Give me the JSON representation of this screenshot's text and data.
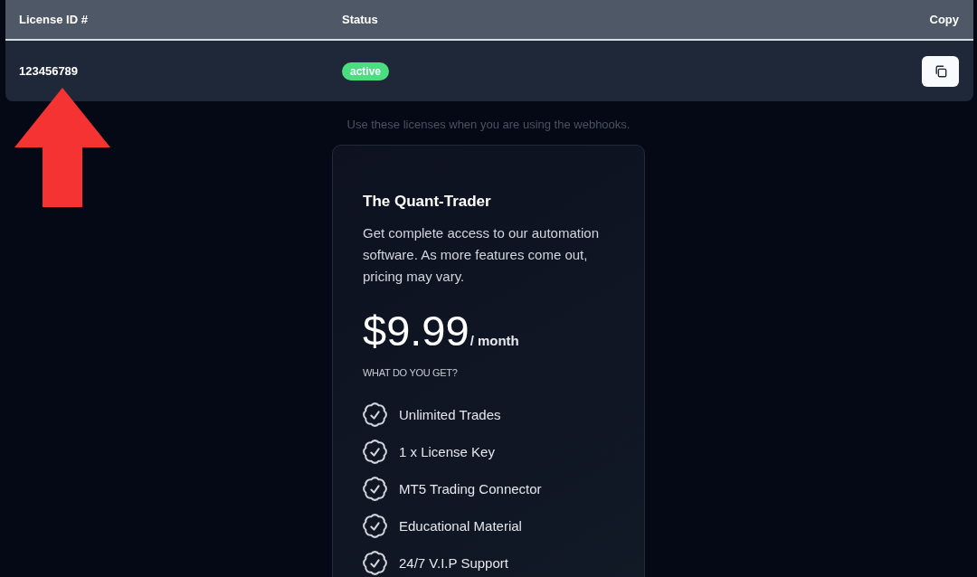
{
  "table": {
    "columns": [
      "License ID #",
      "Status",
      "Copy"
    ],
    "rows": [
      {
        "license_id": "123456789",
        "status": "active"
      }
    ]
  },
  "note": "Use these licenses when you are using the webhooks.",
  "plan": {
    "title": "The Quant-Trader",
    "description": "Get complete access to our automation software. As more features come out, pricing may vary.",
    "price": "$9.99",
    "period": "/ month",
    "features_heading": "WHAT DO YOU GET?",
    "features": [
      "Unlimited Trades",
      "1 x License Key",
      "MT5 Trading Connector",
      "Educational Material",
      "24/7 V.I.P Support"
    ]
  }
}
